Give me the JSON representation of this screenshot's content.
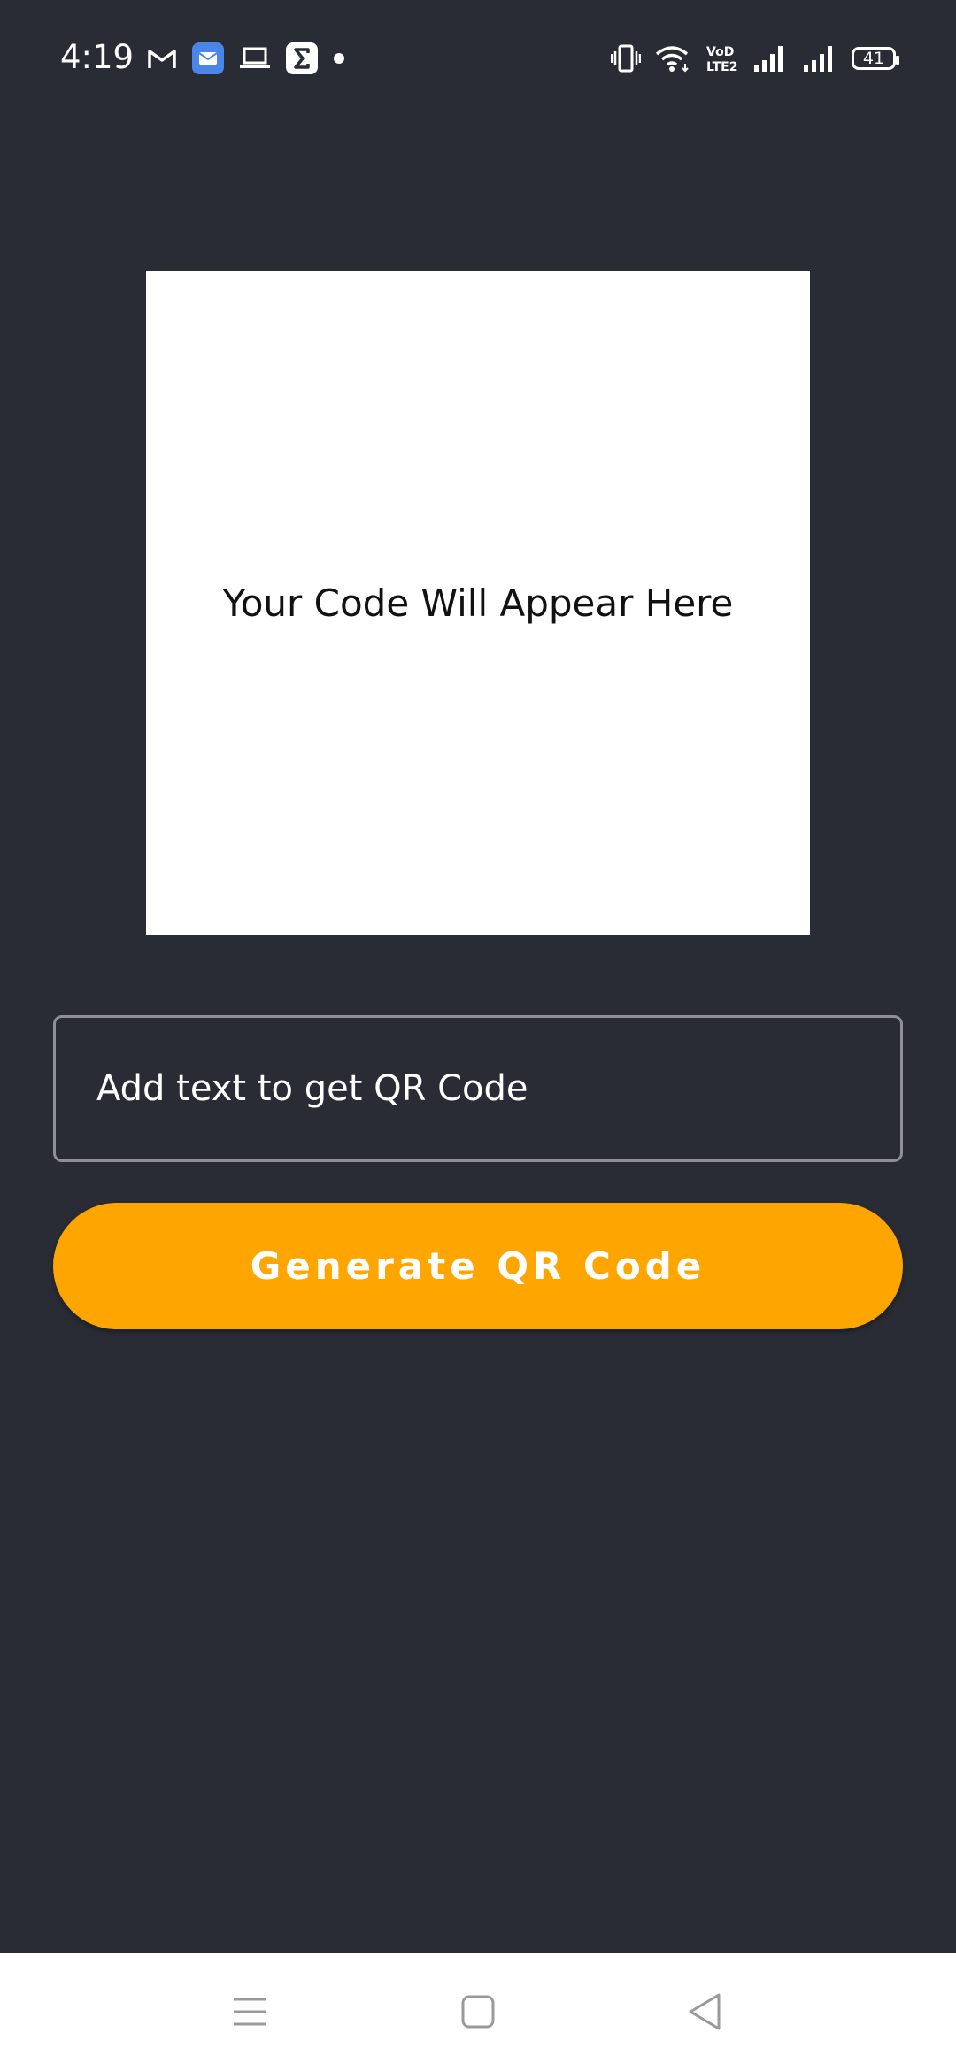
{
  "status_bar": {
    "time": "4:19",
    "battery_level": "41",
    "left_icons": [
      "gmail-icon",
      "messages-icon",
      "laptop-icon",
      "sigma-app-icon",
      "notification-dot-icon"
    ],
    "right_icons": [
      "vibrate-icon",
      "wifi-icon",
      "volte-icon",
      "signal-1-icon",
      "signal-2-icon",
      "battery-icon"
    ]
  },
  "qr_display": {
    "placeholder_text": "Your Code Will Appear Here"
  },
  "input": {
    "placeholder": "Add text to get QR Code",
    "value": ""
  },
  "generate_button": {
    "label": "Generate QR Code"
  },
  "nav_bar": {
    "icons": [
      "menu-icon",
      "home-icon",
      "back-icon"
    ]
  },
  "colors": {
    "background": "#292c35",
    "accent": "#ffa500",
    "qr_box": "#ffffff",
    "input_border": "#8e9096"
  }
}
